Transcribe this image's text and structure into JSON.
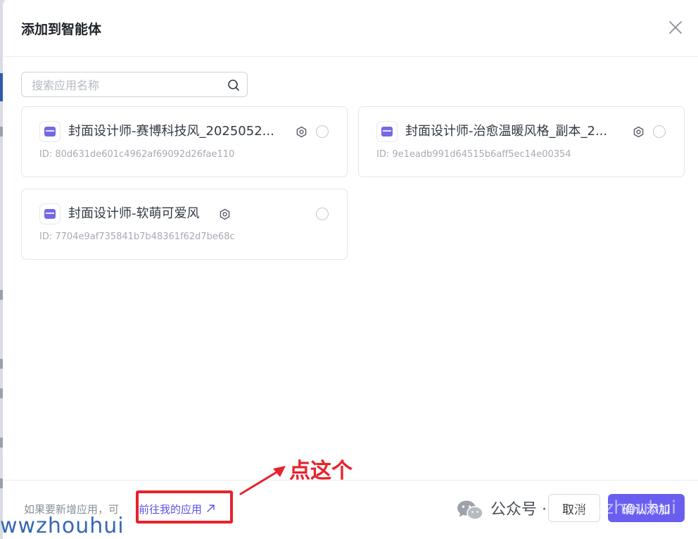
{
  "dialog": {
    "title": "添加到智能体",
    "close_icon": "close-icon"
  },
  "search": {
    "placeholder": "搜索应用名称",
    "value": "",
    "icon": "search-icon"
  },
  "apps": [
    {
      "name": "封面设计师-赛博科技风_2025052...",
      "id_label": "ID:",
      "id": "80d631de601c4962af69092d26fae110",
      "selected": false
    },
    {
      "name": "封面设计师-治愈温暖风格_副本_2...",
      "id_label": "ID:",
      "id": "9e1eadb991d64515b6aff5ec14e00354",
      "selected": false
    },
    {
      "name": "封面设计师-软萌可爱风",
      "id_label": "ID:",
      "id": "7704e9af735841b7b48361f62d7be68c",
      "selected": false
    }
  ],
  "footer": {
    "hint": "如果要新增应用，可",
    "link": "前往我的应用",
    "link_icon": "external-arrow-icon",
    "annotation": "点这个",
    "cancel": "取消",
    "confirm": "确认添加"
  },
  "watermarks": {
    "wechat_name": "公众号 ·",
    "corner": "wwzhouhui",
    "overlay": "wwzhouhui"
  },
  "colors": {
    "accent": "#6a5ef0",
    "link": "#5b54e6",
    "annotation_red": "#e8222c",
    "watermark_blue": "#2b5fb3"
  }
}
